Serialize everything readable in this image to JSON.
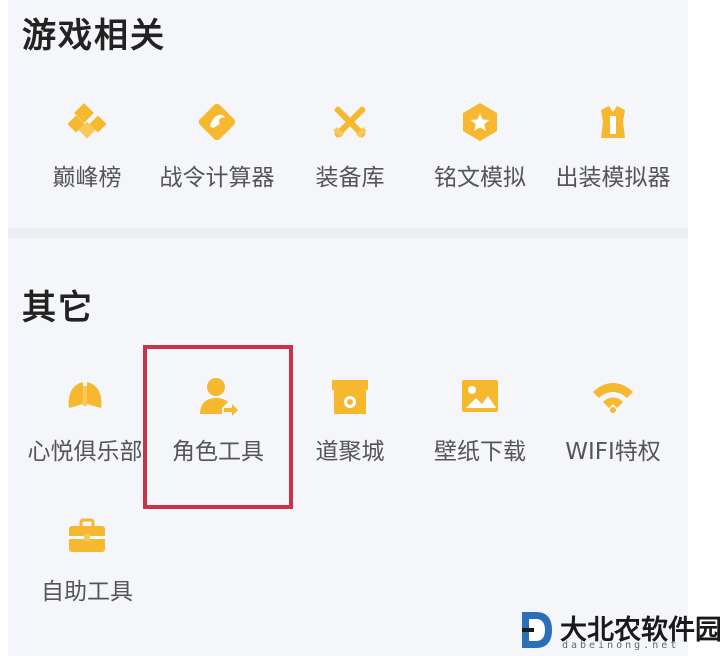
{
  "sections": {
    "game": {
      "title": "游戏相关",
      "items": [
        {
          "label": "巅峰榜",
          "icon": "diamond-badge-icon"
        },
        {
          "label": "战令计算器",
          "icon": "dragon-emblem-icon"
        },
        {
          "label": "装备库",
          "icon": "crossed-swords-icon"
        },
        {
          "label": "铭文模拟",
          "icon": "hexagon-star-icon"
        },
        {
          "label": "出装模拟器",
          "icon": "armor-icon"
        }
      ]
    },
    "other": {
      "title": "其它",
      "items": [
        {
          "label": "心悦俱乐部",
          "icon": "wings-icon"
        },
        {
          "label": "角色工具",
          "icon": "user-share-icon"
        },
        {
          "label": "道聚城",
          "icon": "shop-icon"
        },
        {
          "label": "壁纸下载",
          "icon": "picture-icon"
        },
        {
          "label": "WIFI特权",
          "icon": "wifi-icon"
        },
        {
          "label": "自助工具",
          "icon": "toolbox-icon"
        }
      ]
    }
  },
  "watermark": {
    "text": "大北农软件园",
    "subtext": "dabeinong.net"
  },
  "colors": {
    "icon": "#f5b82e",
    "highlight": "#c8344a",
    "panel": "#f4f6f9"
  }
}
